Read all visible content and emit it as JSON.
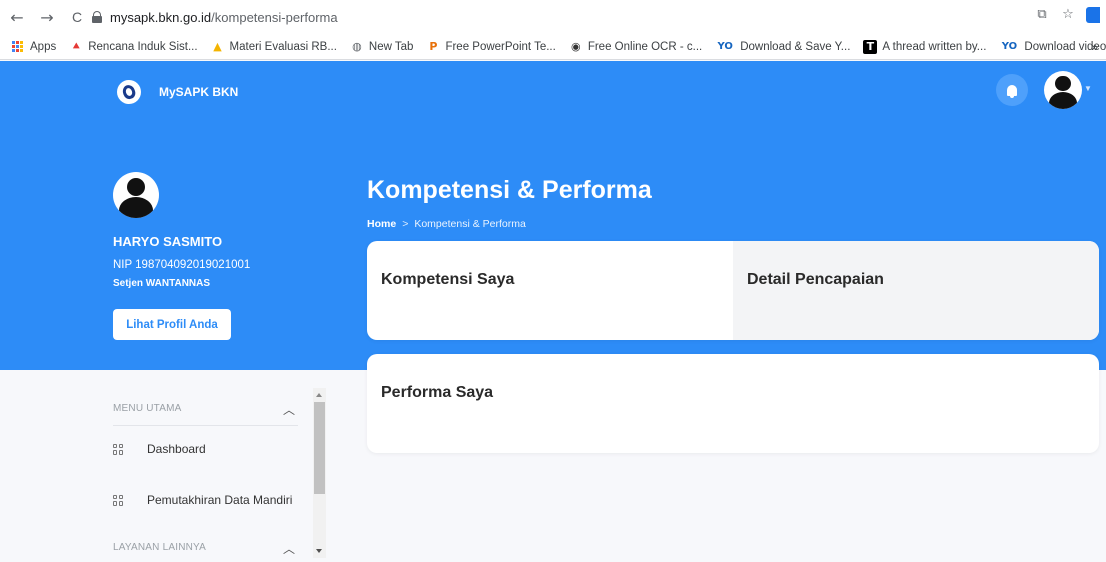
{
  "browser": {
    "url_host": "mysapk.bkn.go.id",
    "url_path": "/kompetensi-performa",
    "nav": {
      "back": "←",
      "forward": "→",
      "reload": "C"
    },
    "bookmarks": [
      {
        "label": "Apps",
        "icon": "apps-grid-icon"
      },
      {
        "label": "Rencana Induk Sist...",
        "icon": "red-figure-icon",
        "glyph": "⯅",
        "color": "#e53935"
      },
      {
        "label": "Materi Evaluasi RB...",
        "icon": "drive-icon",
        "glyph": "▲",
        "color": "#f4b400"
      },
      {
        "label": "New Tab",
        "icon": "globe-icon",
        "glyph": "◍",
        "color": "#5f6368"
      },
      {
        "label": "Free PowerPoint Te...",
        "icon": "p-icon",
        "glyph": "P",
        "color": "#e8710a"
      },
      {
        "label": "Free Online OCR - c...",
        "icon": "ocr-icon",
        "glyph": "◉",
        "color": "#333333"
      },
      {
        "label": "Download & Save Y...",
        "icon": "yo-icon",
        "glyph": "YO",
        "color": "#1565c0"
      },
      {
        "label": "A thread written by...",
        "icon": "t-icon",
        "glyph": "T",
        "color": "#000000"
      },
      {
        "label": "Download video: Li...",
        "icon": "yo-icon",
        "glyph": "YO",
        "color": "#1565c0"
      }
    ],
    "bookmarks_more": "»"
  },
  "app": {
    "brand": "MySAPK BKN",
    "accent": "#2d8cf7",
    "user": {
      "name": "HARYO SASMITO",
      "nip": "NIP 198704092019021001",
      "unit": "Setjen WANTANNAS",
      "profile_button": "Lihat Profil Anda"
    },
    "page_title": "Kompetensi & Performa",
    "breadcrumb": {
      "home": "Home",
      "separator": ">",
      "current": "Kompetensi & Performa"
    },
    "cards": {
      "kompetensi": "Kompetensi Saya",
      "detail": "Detail Pencapaian",
      "performa": "Performa Saya"
    },
    "sidebar": {
      "menu_utama": "MENU UTAMA",
      "items": [
        {
          "label": "Dashboard"
        },
        {
          "label": "Pemutakhiran Data Mandiri"
        }
      ],
      "layanan_lainnya": "LAYANAN LAINNYA"
    }
  }
}
